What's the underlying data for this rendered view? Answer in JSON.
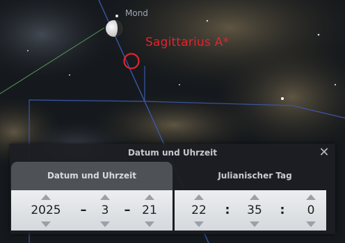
{
  "sky": {
    "moon_label": "Mond",
    "target_label": "Sagittarius A*",
    "colors": {
      "target": "#e2242c",
      "grid": "#3b57a8",
      "ecliptic": "#5a9a5a"
    }
  },
  "dialog": {
    "title": "Datum und Uhrzeit",
    "close_icon": "close-icon",
    "tabs": [
      {
        "label": "Datum und Uhrzeit",
        "active": true
      },
      {
        "label": "Julianischer Tag",
        "active": false
      }
    ],
    "date": {
      "year": "2025",
      "month": "3",
      "day": "21",
      "separator": "–"
    },
    "time": {
      "hour": "22",
      "minute": "35",
      "second": "0",
      "separator": ":"
    }
  }
}
